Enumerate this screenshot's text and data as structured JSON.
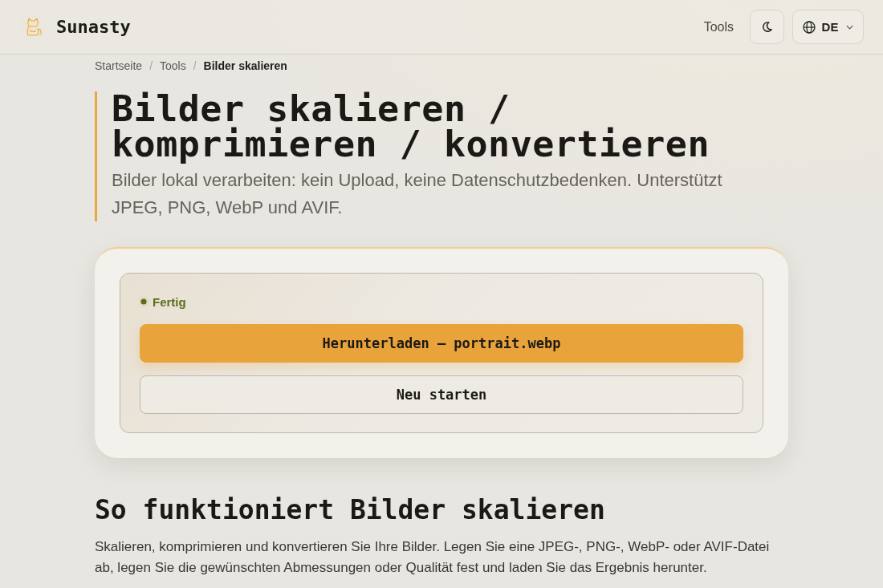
{
  "header": {
    "logo_text": "Sunasty",
    "nav": [
      {
        "label": "Tools"
      }
    ],
    "language": {
      "label": "DE"
    }
  },
  "breadcrumb": [
    {
      "label": "Startseite",
      "current": false,
      "separator": "/"
    },
    {
      "label": "Tools",
      "current": false,
      "separator": "/"
    },
    {
      "label": "Bilder skalieren",
      "current": true
    }
  ],
  "page": {
    "title": "Bilder skalieren / komprimieren / konvertieren",
    "subtitle": "Bilder lokal verarbeiten: kein Upload, keine Datenschutzbedenken. Unterstützt JPEG, PNG, WebP und AVIF."
  },
  "tool_card": {
    "status": {
      "label": "Fertig",
      "kind": "done"
    },
    "buttons": [
      {
        "label": "Herunterladen — portrait.webp",
        "kind": "primary"
      },
      {
        "label": "Neu starten",
        "kind": "secondary"
      }
    ]
  },
  "section": {
    "heading": "So funktioniert Bilder skalieren",
    "text": "Skalieren, komprimieren und konvertieren Sie Ihre Bilder. Legen Sie eine JPEG-, PNG-, WebP- oder AVIF-Datei ab, legen Sie die gewünschten Abmessungen oder Qualität fest und laden Sie das Ergebnis herunter."
  }
}
